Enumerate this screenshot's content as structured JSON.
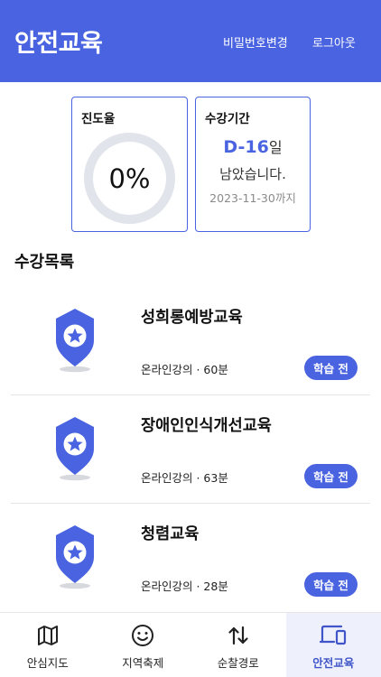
{
  "header": {
    "title": "안전교육",
    "change_password": "비밀번호변경",
    "logout": "로그아웃"
  },
  "progress_card": {
    "title": "진도율",
    "value": "0%",
    "percent": 0
  },
  "period_card": {
    "title": "수강기간",
    "dday": "D-16",
    "dday_suffix": "일",
    "remain": "남았습니다.",
    "until": "2023-11-30까지"
  },
  "section": {
    "title": "수강목록"
  },
  "courses": [
    {
      "name": "성희롱예방교육",
      "meta": "온라인강의 · 60분",
      "status": "학습 전"
    },
    {
      "name": "장애인인식개선교육",
      "meta": "온라인강의 · 63분",
      "status": "학습 전"
    },
    {
      "name": "청렴교육",
      "meta": "온라인강의 · 28분",
      "status": "학습 전"
    }
  ],
  "nav": {
    "items": [
      {
        "label": "안심지도",
        "icon": "map-icon"
      },
      {
        "label": "지역축제",
        "icon": "smile-icon"
      },
      {
        "label": "순찰경로",
        "icon": "route-arrows-icon"
      },
      {
        "label": "안전교육",
        "icon": "devices-icon"
      }
    ],
    "active": "안전교육"
  },
  "colors": {
    "accent": "#4a63e0",
    "ring_track": "#e1e4ea",
    "active_tab_bg": "#eef1fb"
  }
}
